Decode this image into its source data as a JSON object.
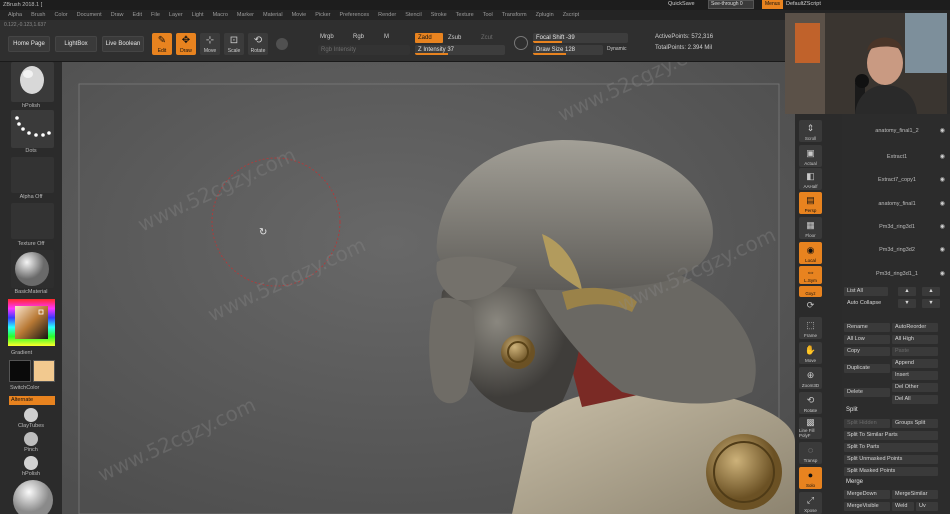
{
  "title_bar": {
    "title": "ZBrush 2018.1 [",
    "quicksave": "QuickSave",
    "see_through": "See-through  0",
    "menus": "Menus",
    "default_zscript": "DefaultZScript"
  },
  "menu_bar": {
    "items": [
      "Alpha",
      "Brush",
      "Color",
      "Document",
      "Draw",
      "Edit",
      "File",
      "Layer",
      "Light",
      "Macro",
      "Marker",
      "Material",
      "Movie",
      "Picker",
      "Preferences",
      "Render",
      "Stencil",
      "Stroke",
      "Texture",
      "Tool",
      "Transform",
      "Zplugin",
      "Zscript"
    ]
  },
  "toolbar": {
    "home_page": "Home Page",
    "lightbox": "LightBox",
    "live_boolean": "Live Boolean",
    "modes": [
      {
        "label": "Edit",
        "icon": "edit-icon",
        "active": true
      },
      {
        "label": "Draw",
        "icon": "draw-icon",
        "active": true
      },
      {
        "label": "Move",
        "icon": "move-icon",
        "active": false
      },
      {
        "label": "Scale",
        "icon": "scale-icon",
        "active": false
      },
      {
        "label": "Rotate",
        "icon": "rotate-icon",
        "active": false
      }
    ],
    "mrgb": "Mrgb",
    "rgb": "Rgb",
    "m": "M",
    "rgb_intensity": "Rgb Intensity",
    "zadd": "Zadd",
    "zsub": "Zsub",
    "zcut": "Zcut",
    "z_intensity": "Z Intensity 37",
    "focal_shift": "Focal Shift -39",
    "draw_size": "Draw Size 128",
    "dynamic": "Dynamic",
    "active_points": "ActivePoints: 572,316",
    "total_points": "TotalPoints: 2.394 Mil",
    "coords": "0.122,-0.123,1.637"
  },
  "left_shelf": {
    "brush_label": "hPolish",
    "stroke_label": "Dots",
    "alpha_label": "Alpha Off",
    "texture_label": "Texture Off",
    "material_label": "BasicMaterial",
    "gradient_label": "Gradient",
    "switch_color": "SwitchColor",
    "alternate": "Alternate",
    "brushes": [
      "ClayTubes",
      "Pinch",
      "hPolish"
    ],
    "colors": {
      "main": "#0a0a0a",
      "secondary": "#f2c98f",
      "accent": "#e8831f"
    }
  },
  "right_shelf": {
    "buttons": [
      {
        "label": "Scroll",
        "icon": "scroll-icon",
        "active": false
      },
      {
        "label": "Actual",
        "icon": "actual-icon",
        "active": false
      },
      {
        "label": "AAHalf",
        "icon": "aahalf-icon",
        "active": false
      },
      {
        "label": "Persp",
        "icon": "persp-icon",
        "active": true
      },
      {
        "label": "Floor",
        "icon": "floor-icon",
        "active": false
      },
      {
        "label": "Local",
        "icon": "local-icon",
        "active": true
      },
      {
        "label": "L.Sym",
        "icon": "lsym-icon",
        "active": true
      },
      {
        "label": "Gxyz",
        "icon": "xyz-icon",
        "active": true
      },
      {
        "label": "Frame",
        "icon": "frame-icon",
        "active": false
      },
      {
        "label": "Move",
        "icon": "move-icon",
        "active": false
      },
      {
        "label": "Zoom3D",
        "icon": "zoom-icon",
        "active": false
      },
      {
        "label": "Rotate",
        "icon": "rotate-icon",
        "active": false
      },
      {
        "label": "Line Fill PolyF",
        "icon": "polyframe-icon",
        "active": false
      },
      {
        "label": "Transp",
        "icon": "transp-icon",
        "active": false
      },
      {
        "label": "Solo",
        "icon": "solo-icon",
        "active": false
      },
      {
        "label": "Xpose",
        "icon": "xpose-icon",
        "active": false
      }
    ]
  },
  "subtool_panel": {
    "subtools": [
      "anatomy_final1_2",
      "Extract1",
      "Extract7_copy1",
      "anatomy_final1",
      "Pm3d_ring3d1",
      "Pm3d_ring3d2",
      "Pm3d_ring3d1_1"
    ],
    "list_all": "List All",
    "auto_collapse": "Auto Collapse",
    "rename": "Rename",
    "auto_reorder": "AutoReorder",
    "all_low": "All Low",
    "all_high": "All High",
    "copy": "Copy",
    "paste": "Paste",
    "duplicate": "Duplicate",
    "append": "Append",
    "insert": "Insert",
    "delete": "Delete",
    "del_other": "Del Other",
    "del_all": "Del All",
    "split_header": "Split",
    "split_hidden": "Split Hidden",
    "groups_split": "Groups Split",
    "split_similar": "Split To Similar Parts",
    "split_parts": "Split To Parts",
    "split_unmasked": "Split Unmasked Points",
    "split_masked": "Split Masked Points",
    "merge_header": "Merge",
    "merge_down": "MergeDown",
    "merge_similar": "MergeSimilar",
    "merge_visible": "MergeVisible",
    "weld": "Weld",
    "uv": "Uv"
  },
  "watermark": "www.52cgzy.com"
}
